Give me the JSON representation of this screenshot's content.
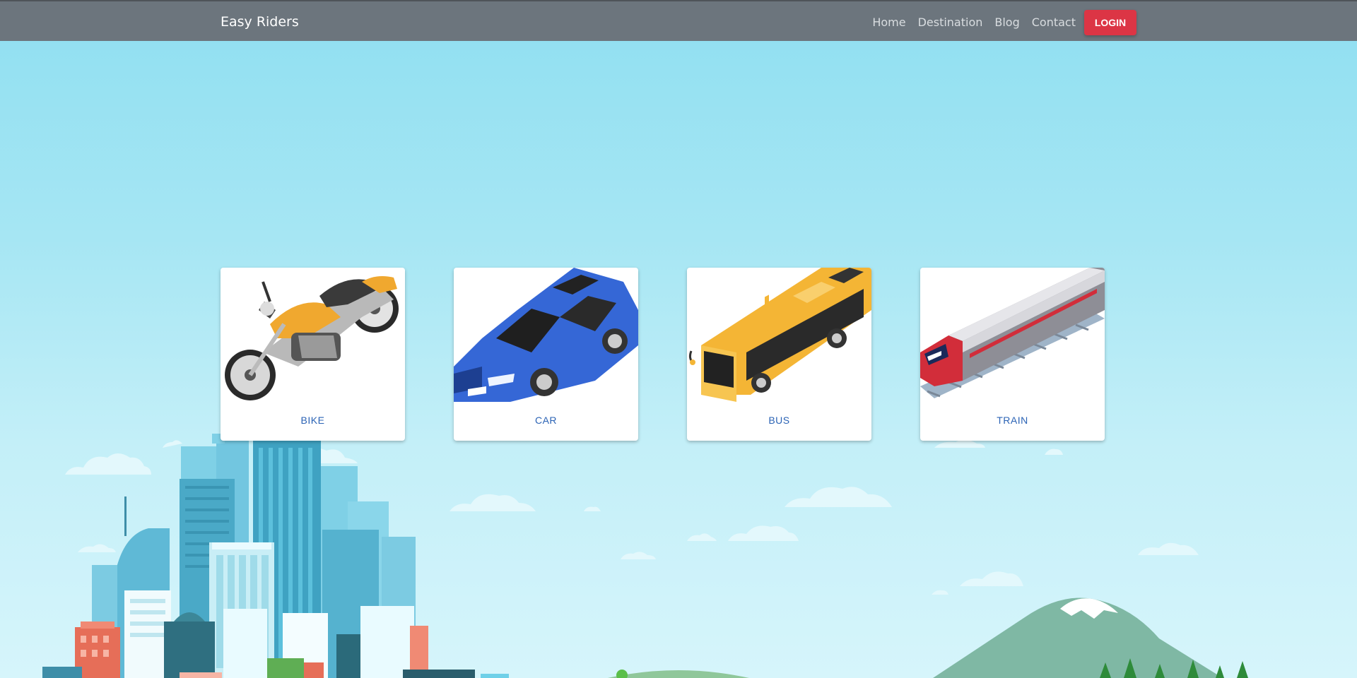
{
  "navbar": {
    "brand": "Easy Riders",
    "links": [
      "Home",
      "Destination",
      "Blog",
      "Contact"
    ],
    "login_label": "LOGIN"
  },
  "cards": [
    {
      "label": "BIKE",
      "icon": "motorcycle-icon"
    },
    {
      "label": "CAR",
      "icon": "car-icon"
    },
    {
      "label": "BUS",
      "icon": "bus-icon"
    },
    {
      "label": "TRAIN",
      "icon": "train-icon"
    }
  ],
  "colors": {
    "navbar_bg": "#6c757d",
    "login_bg": "#dc3545",
    "card_label": "#2b63b5",
    "sky_top": "#8fdff2",
    "sky_bottom": "#d6f5fb"
  }
}
